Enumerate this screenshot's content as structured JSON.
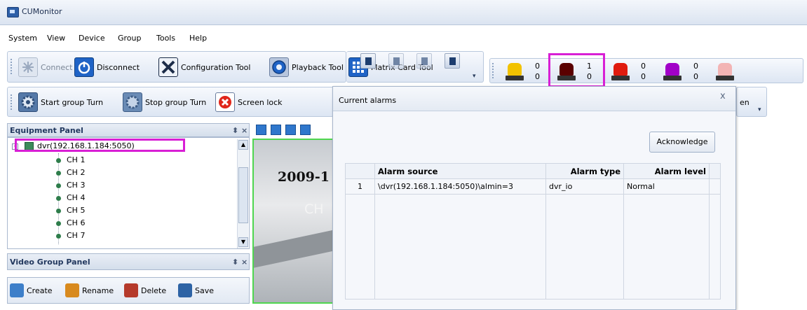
{
  "window": {
    "title": "CUMonitor"
  },
  "menu": [
    "System",
    "View",
    "Device",
    "Group",
    "Tools",
    "Help"
  ],
  "toolbar1": {
    "buttons": [
      {
        "label": "Connect",
        "icon": "asterisk-icon",
        "disabled": true
      },
      {
        "label": "Disconnect",
        "icon": "power-icon"
      },
      {
        "label": "Configuration Tool",
        "icon": "tools-icon"
      },
      {
        "label": "Playback Tool",
        "icon": "playback-icon"
      },
      {
        "label": "Matrix Card Tool",
        "icon": "matrix-icon"
      }
    ]
  },
  "alarm_lights": [
    {
      "color": "#f2c200",
      "top": "0",
      "bottom": "0"
    },
    {
      "color": "#5a0000",
      "top": "1",
      "bottom": "0"
    },
    {
      "color": "#e01b0e",
      "top": "0",
      "bottom": "0"
    },
    {
      "color": "#a100c8",
      "top": "0",
      "bottom": "0"
    },
    {
      "color": "#f3b4b4"
    }
  ],
  "toolbar2": {
    "buttons": [
      {
        "label": "Start group Turn",
        "icon": "gear-icon"
      },
      {
        "label": "Stop group Turn",
        "icon": "gear-stop-icon"
      },
      {
        "label": "Screen lock",
        "icon": "lock-screen-icon"
      }
    ],
    "overflow_label": "en"
  },
  "equipment_panel": {
    "title": "Equipment Panel",
    "pin_close": "⬍ ×",
    "device": "dvr(192.168.1.184:5050)",
    "channels": [
      "CH 1",
      "CH 2",
      "CH 3",
      "CH 4",
      "CH 5",
      "CH 6",
      "CH 7"
    ]
  },
  "video_group_panel": {
    "title": "Video Group Panel",
    "pin_close": "⬍ ×",
    "actions": [
      "Create",
      "Rename",
      "Delete",
      "Save"
    ]
  },
  "video_preview": {
    "date_text": "2009-1",
    "channel_text": "CH"
  },
  "dialog": {
    "title": "Current alarms",
    "close": "x",
    "acknowledge_label": "Acknowledge",
    "columns": [
      "",
      "Alarm source",
      "Alarm type",
      "Alarm level"
    ],
    "rows": [
      {
        "index": "1",
        "source": "\\dvr(192.168.1.184:5050)\\almin=3",
        "type": "dvr_io",
        "level": "Normal"
      }
    ]
  }
}
